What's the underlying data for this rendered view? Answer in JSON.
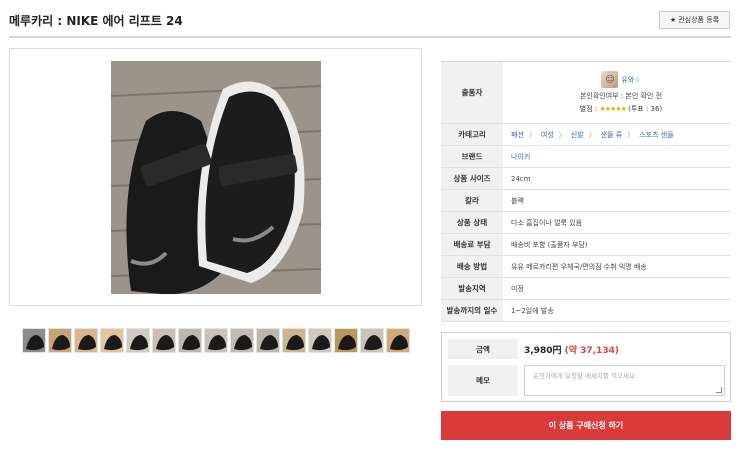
{
  "page": {
    "title": "메루카리 : NIKE 에어 리프트 24",
    "fav_icon": "★",
    "fav_label": "관심상품 등록"
  },
  "seller": {
    "avatar_icon": "person-avatar",
    "name": "유와☆",
    "verify": "본인확인여부 : 본인 확인 전",
    "rating_label": "별점 :",
    "stars": "★★★★★",
    "votes": "(투표 : 36)"
  },
  "info": {
    "seller_label": "출품자",
    "category_label": "카테고리",
    "category": [
      "패션",
      "여성",
      "신발",
      "샌들 류",
      "스포츠 샌들"
    ],
    "category_sep": "〉",
    "rows": [
      {
        "label": "브랜드",
        "value": "나이키",
        "link": true
      },
      {
        "label": "상품 사이즈",
        "value": "24cm"
      },
      {
        "label": "칼라",
        "value": "블랙"
      },
      {
        "label": "상품 상태",
        "value": "다소 흠집이나 얼룩 있음"
      },
      {
        "label": "배송료 부담",
        "value": "배송비 포함 (출품자 부담)"
      },
      {
        "label": "배송 방법",
        "value": "유유 메르카리편 우체국/편의점 수취 익명 배송"
      },
      {
        "label": "발송지역",
        "value": "미정"
      },
      {
        "label": "발송까지의 일수",
        "value": "1~2일에 발송"
      }
    ]
  },
  "order": {
    "price_label": "금액",
    "price_jpy": "3,980円",
    "price_krw": "(약 37,134)",
    "memo_label": "메모",
    "memo_placeholder": "운영자에게 요청할 메세지를 적으세요."
  },
  "buy_button": "이 상품 구매신청 하기",
  "thumbnails": 15,
  "colors": {
    "accent_red": "#d93a3a",
    "link_blue": "#2f6bc1",
    "star": "#f0a800"
  }
}
